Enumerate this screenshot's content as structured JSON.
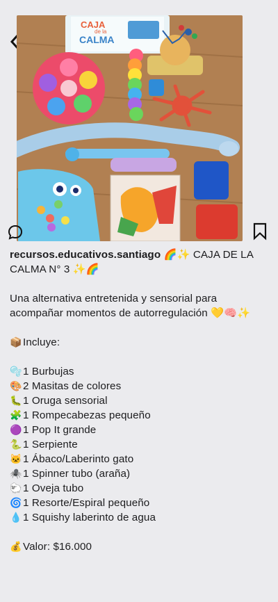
{
  "post": {
    "username": "recursos.educativos.santiago",
    "title_after": " 🌈✨ CAJA DE LA",
    "title_line2": "CALMA N° 3 ✨🌈",
    "desc_line1": "Una alternativa entretenida y sensorial para",
    "desc_line2": "acompañar momentos de autorregulación 💛🧠✨",
    "includes_icon": "📦",
    "includes_label": "Incluye:",
    "items": [
      {
        "icon": "🫧",
        "text": "1 Burbujas"
      },
      {
        "icon": "🎨",
        "text": "2 Masitas de colores"
      },
      {
        "icon": "🐛",
        "text": "1 Oruga sensorial"
      },
      {
        "icon": "🧩",
        "text": "1 Rompecabezas pequeño"
      },
      {
        "icon": "🟣",
        "text": "1 Pop It grande"
      },
      {
        "icon": "🐍",
        "text": "1 Serpiente"
      },
      {
        "icon": "🐱",
        "text": "1 Ábaco/Laberinto gato"
      },
      {
        "icon": "🕷️",
        "text": "1 Spinner tubo (araña)"
      },
      {
        "icon": "🐑",
        "text": "1 Oveja tubo"
      },
      {
        "icon": "🌀",
        "text": "1 Resorte/Espiral pequeño"
      },
      {
        "icon": "💧",
        "text": "1 Squishy laberinto de agua"
      }
    ],
    "price_icon": "💰",
    "price_text": "Valor: $16.000"
  },
  "photo": {
    "box_label_1": "CAJA",
    "box_label_2": "de la",
    "box_label_3": "CALMA"
  },
  "icons": {
    "back": "back-arrow-icon",
    "comment": "comment-icon",
    "bookmark": "bookmark-icon"
  }
}
